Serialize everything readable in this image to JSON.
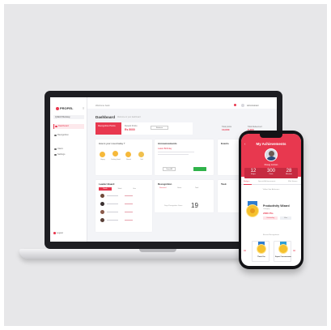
{
  "laptop": {
    "logo": "PROPEL",
    "user_chip": "QUEAN Meldway",
    "nav": [
      {
        "label": "Dashboard"
      },
      {
        "label": "Recognition"
      },
      {
        "label": "Users"
      },
      {
        "label": "Settings"
      }
    ],
    "logout": "Logout",
    "welcome": "Welcome back",
    "user_name": "Administrator",
    "title": "Dashboard",
    "subtitle": "Welcome to your dashboard",
    "banner": "Recognition Points",
    "points_label": "Reward Points",
    "points_value": "Rs 5000",
    "redeem_button": "Redeem",
    "stat_1_label": "Total points",
    "stat_1_value": "10,000",
    "stat_2_label": "Total Redeemed",
    "stat_2_value": "5,000",
    "mood_title": "How is your mood today ?",
    "moods": [
      "Happy",
      "Feeling Good",
      "Normal",
      "Sad"
    ],
    "announcements_title": "Announcements",
    "announcement_heading": "Latest Birthday",
    "view_button": "View All",
    "leaderboard_title": "Leader Board",
    "leaderboard_tabs": [
      "Month",
      "Week",
      "Year"
    ],
    "recognition_title": "Recognition",
    "recognition_tabs": [
      "Received",
      "Given",
      "Total"
    ],
    "recognition_value": "19",
    "recognition_label": "Days Recognition Given",
    "events_title": "Events",
    "task_title": "Task"
  },
  "phone": {
    "title": "My Achievements",
    "name": "Doug Linton",
    "stats": [
      {
        "value": "12",
        "label": "Badges"
      },
      {
        "value": "300",
        "label": "Points"
      },
      {
        "value": "28",
        "label": "Milestones"
      }
    ],
    "tabs": [
      "Badges",
      "Special Achievements",
      "Mile Stones"
    ],
    "section_badges": "Yellow Star Achievers",
    "badge_title": "Productivity Wizard",
    "badge_sub": "Category",
    "badge_points": "2000 Pts",
    "badge_btn_1": "Outstanding",
    "badge_btn_2": "View",
    "section_recent": "Recent Recognitions",
    "rec_cards": [
      {
        "label": "Thank You",
        "points": "02"
      },
      {
        "label": "Expert Communicator",
        "points": "02"
      }
    ]
  },
  "colors": {
    "accent": "#e8384f",
    "background": "#e7e7e9",
    "green": "#30b34a",
    "gold": "#f5c12e"
  }
}
